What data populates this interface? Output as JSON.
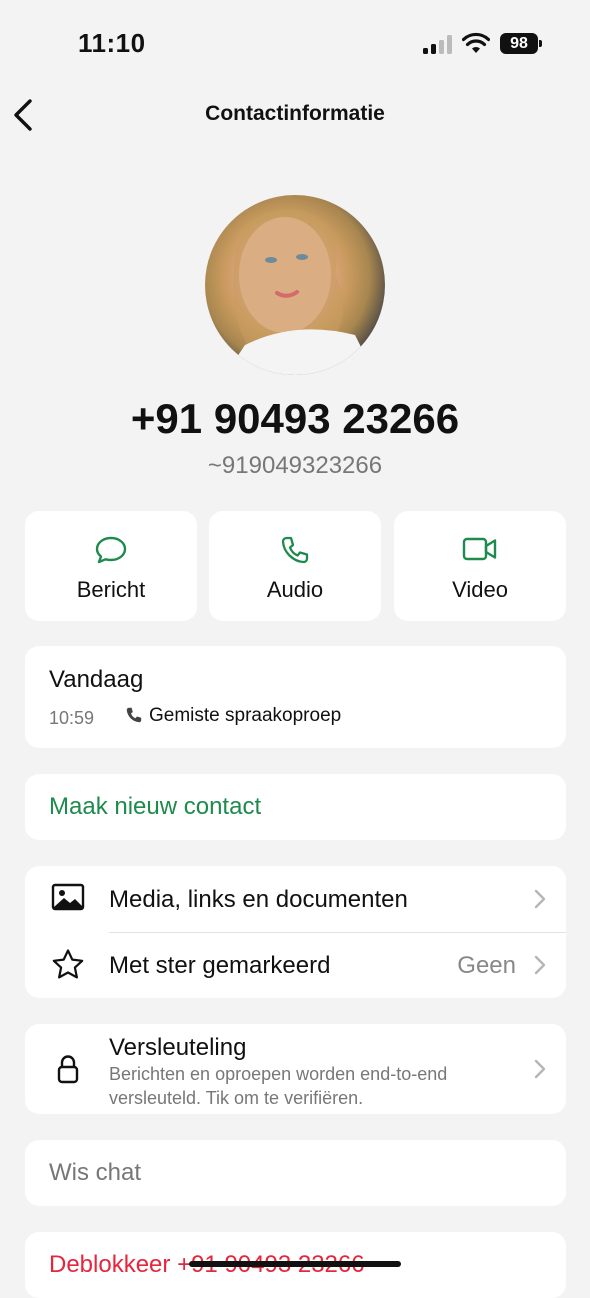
{
  "status_bar": {
    "time": "11:10",
    "battery": "98"
  },
  "nav": {
    "title": "Contactinformatie"
  },
  "contact": {
    "phone": "+91 90493 23266",
    "alias": "~919049323266"
  },
  "actions": [
    {
      "label": "Bericht",
      "icon": "message-icon"
    },
    {
      "label": "Audio",
      "icon": "phone-icon"
    },
    {
      "label": "Video",
      "icon": "video-icon"
    }
  ],
  "call_log": {
    "day": "Vandaag",
    "time": "10:59",
    "description": "Gemiste spraakoproep"
  },
  "new_contact": {
    "label": "Maak nieuw contact"
  },
  "media": {
    "media_label": "Media, links en documenten",
    "starred_label": "Met ster gemarkeerd",
    "starred_value": "Geen"
  },
  "encryption": {
    "title": "Versleuteling",
    "subtitle": "Berichten en oproepen worden end-to-end versleuteld. Tik om te verifiëren."
  },
  "clear_chat": {
    "label": "Wis chat"
  },
  "unblock": {
    "label": "Deblokkeer +91 90493 23266"
  },
  "colors": {
    "accent_green": "#1e8a4c",
    "danger_red": "#e5263d",
    "background": "#f3f3f3"
  }
}
